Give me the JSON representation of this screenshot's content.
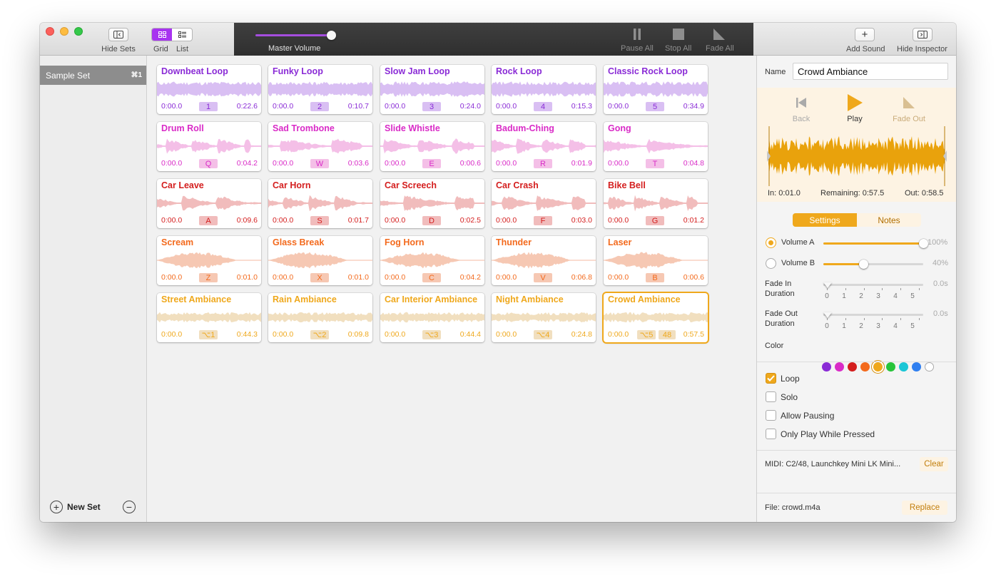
{
  "toolbar": {
    "hide_sets": "Hide Sets",
    "grid": "Grid",
    "list": "List",
    "master_volume": "Master Volume",
    "master_volume_level": 1.0,
    "pause_all": "Pause All",
    "stop_all": "Stop All",
    "fade_all": "Fade All",
    "add_sound": "Add Sound",
    "hide_inspector": "Hide Inspector"
  },
  "sidebar": {
    "sets": [
      {
        "label": "Sample Set",
        "shortcut": "⌘1"
      }
    ],
    "new_set": "New Set"
  },
  "colors": {
    "purple": "#8a2bd6",
    "magenta": "#d92bc7",
    "red": "#d41e1e",
    "orange": "#f36a1d",
    "amber": "#efa81c",
    "purple_bg": "#d9bff3",
    "magenta_bg": "#f4bfe7",
    "red_bg": "#f1bcbc",
    "orange_bg": "#f6c8b3",
    "amber_bg": "#f1dfbf"
  },
  "tiles": [
    {
      "name": "Downbeat Loop",
      "start": "0:00.0",
      "key": "1",
      "end": "0:22.6",
      "color": "purple"
    },
    {
      "name": "Funky Loop",
      "start": "0:00.0",
      "key": "2",
      "end": "0:10.7",
      "color": "purple"
    },
    {
      "name": "Slow Jam Loop",
      "start": "0:00.0",
      "key": "3",
      "end": "0:24.0",
      "color": "purple"
    },
    {
      "name": "Rock Loop",
      "start": "0:00.0",
      "key": "4",
      "end": "0:15.3",
      "color": "purple"
    },
    {
      "name": "Classic Rock Loop",
      "start": "0:00.0",
      "key": "5",
      "end": "0:34.9",
      "color": "purple"
    },
    {
      "name": "Drum Roll",
      "start": "0:00.0",
      "key": "Q",
      "end": "0:04.2",
      "color": "magenta"
    },
    {
      "name": "Sad Trombone",
      "start": "0:00.0",
      "key": "W",
      "end": "0:03.6",
      "color": "magenta"
    },
    {
      "name": "Slide Whistle",
      "start": "0:00.0",
      "key": "E",
      "end": "0:00.6",
      "color": "magenta"
    },
    {
      "name": "Badum-Ching",
      "start": "0:00.0",
      "key": "R",
      "end": "0:01.9",
      "color": "magenta"
    },
    {
      "name": "Gong",
      "start": "0:00.0",
      "key": "T",
      "end": "0:04.8",
      "color": "magenta"
    },
    {
      "name": "Car Leave",
      "start": "0:00.0",
      "key": "A",
      "end": "0:09.6",
      "color": "red"
    },
    {
      "name": "Car Horn",
      "start": "0:00.0",
      "key": "S",
      "end": "0:01.7",
      "color": "red"
    },
    {
      "name": "Car Screech",
      "start": "0:00.0",
      "key": "D",
      "end": "0:02.5",
      "color": "red"
    },
    {
      "name": "Car Crash",
      "start": "0:00.0",
      "key": "F",
      "end": "0:03.0",
      "color": "red"
    },
    {
      "name": "Bike Bell",
      "start": "0:00.0",
      "key": "G",
      "end": "0:01.2",
      "color": "red"
    },
    {
      "name": "Scream",
      "start": "0:00.0",
      "key": "Z",
      "end": "0:01.0",
      "color": "orange"
    },
    {
      "name": "Glass Break",
      "start": "0:00.0",
      "key": "X",
      "end": "0:01.0",
      "color": "orange"
    },
    {
      "name": "Fog Horn",
      "start": "0:00.0",
      "key": "C",
      "end": "0:04.2",
      "color": "orange"
    },
    {
      "name": "Thunder",
      "start": "0:00.0",
      "key": "V",
      "end": "0:06.8",
      "color": "orange"
    },
    {
      "name": "Laser",
      "start": "0:00.0",
      "key": "B",
      "end": "0:00.6",
      "color": "orange"
    },
    {
      "name": "Street Ambiance",
      "start": "0:00.0",
      "key": "⌥1",
      "end": "0:44.3",
      "color": "amber"
    },
    {
      "name": "Rain Ambiance",
      "start": "0:00.0",
      "key": "⌥2",
      "end": "0:09.8",
      "color": "amber"
    },
    {
      "name": "Car Interior Ambiance",
      "start": "0:00.0",
      "key": "⌥3",
      "end": "0:44.4",
      "color": "amber"
    },
    {
      "name": "Night Ambiance",
      "start": "0:00.0",
      "key": "⌥4",
      "end": "0:24.8",
      "color": "amber"
    },
    {
      "name": "Crowd Ambiance",
      "start": "0:00.0",
      "key": "⌥5",
      "midi": "48",
      "end": "0:57.5",
      "color": "amber",
      "selected": true
    }
  ],
  "inspector": {
    "name_label": "Name",
    "name_value": "Crowd Ambiance",
    "back": "Back",
    "play": "Play",
    "fade_out": "Fade Out",
    "in_time": "In: 0:01.0",
    "remaining": "Remaining: 0:57.5",
    "out_time": "Out: 0:58.5",
    "tab_settings": "Settings",
    "tab_notes": "Notes",
    "volume_a_label": "Volume A",
    "volume_a_pct": "100%",
    "volume_a_level": 1.0,
    "volume_b_label": "Volume B",
    "volume_b_pct": "40%",
    "volume_b_level": 0.4,
    "fade_in_label_1": "Fade In",
    "fade_in_label_2": "Duration",
    "fade_in_value": "0.0s",
    "fade_out_label_1": "Fade Out",
    "fade_out_label_2": "Duration",
    "fade_out_value": "0.0s",
    "scale": [
      "0",
      "1",
      "2",
      "3",
      "4",
      "5"
    ],
    "color_label": "Color",
    "swatches": [
      "#8a2bd6",
      "#d92bc7",
      "#d41e1e",
      "#f36a1d",
      "#efa81c",
      "#27c43a",
      "#1bc6d6",
      "#2f7ff0",
      "#ffffff"
    ],
    "selected_swatch": 4,
    "loop": "Loop",
    "loop_checked": true,
    "solo": "Solo",
    "allow_pausing": "Allow Pausing",
    "only_play": "Only Play While Pressed",
    "midi": "MIDI: C2/48, Launchkey Mini LK Mini...",
    "clear": "Clear",
    "file": "File: crowd.m4a",
    "replace": "Replace"
  }
}
